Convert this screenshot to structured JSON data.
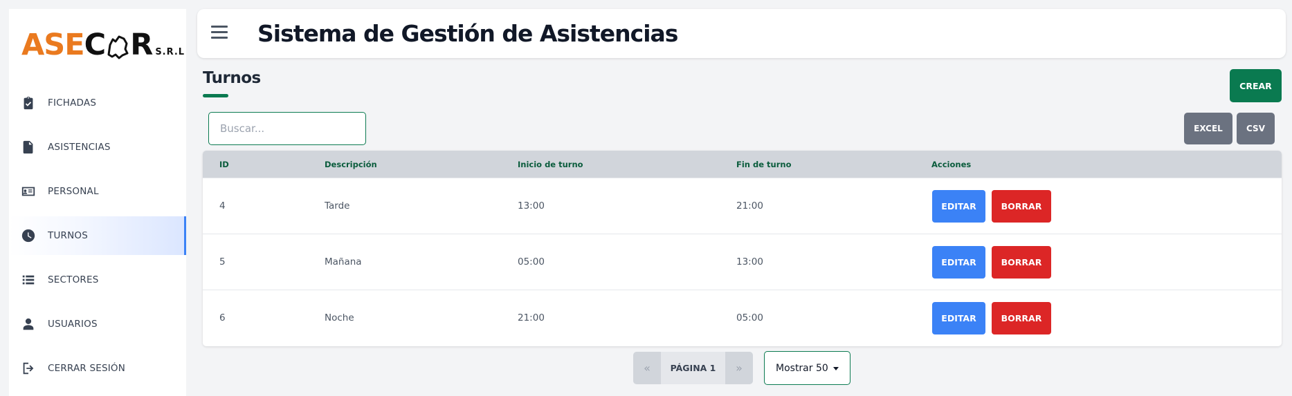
{
  "logo": {
    "part1": "ASE",
    "part2": "C",
    "part3": "R",
    "suffix": "S.R.L"
  },
  "app": {
    "title": "Sistema de Gestión de Asistencias"
  },
  "sidebar": {
    "items": [
      {
        "label": "FICHADAS",
        "icon": "clipboard-check-icon",
        "active": false
      },
      {
        "label": "ASISTENCIAS",
        "icon": "file-icon",
        "active": false
      },
      {
        "label": "PERSONAL",
        "icon": "id-card-icon",
        "active": false
      },
      {
        "label": "TURNOS",
        "icon": "clock-icon",
        "active": true
      },
      {
        "label": "SECTORES",
        "icon": "list-icon",
        "active": false
      },
      {
        "label": "USUARIOS",
        "icon": "user-icon",
        "active": false
      },
      {
        "label": "CERRAR SESIÓN",
        "icon": "logout-icon",
        "active": false
      }
    ]
  },
  "page": {
    "title": "Turnos"
  },
  "toolbar": {
    "create_label": "CREAR",
    "excel_label": "EXCEL",
    "csv_label": "CSV",
    "search_placeholder": "Buscar..."
  },
  "table": {
    "columns": [
      "ID",
      "Descripción",
      "Inicio de turno",
      "Fin de turno",
      "Acciones"
    ],
    "rows": [
      {
        "id": "4",
        "descripcion": "Tarde",
        "inicio": "13:00",
        "fin": "21:00"
      },
      {
        "id": "5",
        "descripcion": "Mañana",
        "inicio": "05:00",
        "fin": "13:00"
      },
      {
        "id": "6",
        "descripcion": "Noche",
        "inicio": "21:00",
        "fin": "05:00"
      }
    ],
    "edit_label": "EDITAR",
    "delete_label": "BORRAR"
  },
  "pagination": {
    "prev": "«",
    "label": "PÁGINA 1",
    "next": "»",
    "page_size": "Mostrar 50"
  },
  "colors": {
    "brand_orange": "#ea7a1f",
    "primary_green": "#0a7a50",
    "edit_blue": "#3b82f6",
    "delete_red": "#dc2626",
    "gray_button": "#6b7280"
  }
}
